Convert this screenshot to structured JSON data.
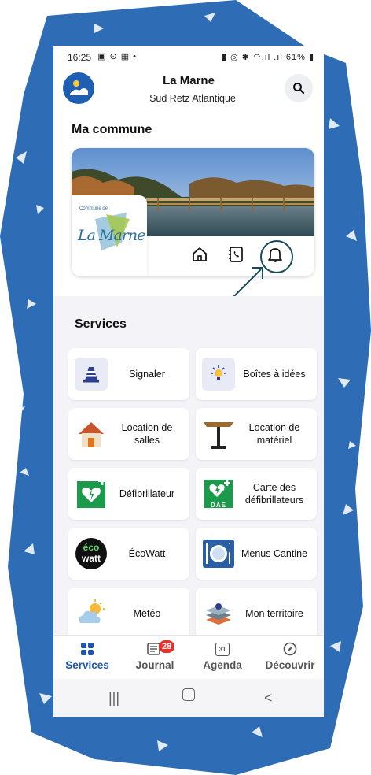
{
  "status_bar": {
    "time": "16:25",
    "left_icons": "▣ ⊙ ▦ •",
    "right_icons": "▮ ◎ ✱ ◠.ıl .ıl",
    "battery": "61%"
  },
  "header": {
    "title": "La Marne",
    "subtitle": "Sud Retz Atlantique"
  },
  "commune": {
    "section_title": "Ma commune",
    "logo_small_text": "Commune de",
    "logo_text": "La Marne"
  },
  "services": {
    "title": "Services",
    "tiles": [
      {
        "label": "Signaler",
        "icon": "cone-icon"
      },
      {
        "label": "Boîtes à idées",
        "icon": "lightbulb-icon"
      },
      {
        "label": "Location de salles",
        "icon": "house-icon"
      },
      {
        "label": "Location de matériel",
        "icon": "table-icon"
      },
      {
        "label": "Défibrillateur",
        "icon": "defibrillator-icon"
      },
      {
        "label": "Carte des défibrillateurs",
        "icon": "dae-icon"
      },
      {
        "label": "ÉcoWatt",
        "icon": "ecowatt-icon"
      },
      {
        "label": "Menus Cantine",
        "icon": "cutlery-icon"
      },
      {
        "label": "Météo",
        "icon": "weather-icon"
      },
      {
        "label": "Mon territoire",
        "icon": "map-layers-icon"
      }
    ],
    "ecowatt_logo": {
      "line1": "éco",
      "line2": "watt"
    },
    "dae_text": "DAE"
  },
  "bottom_nav": {
    "items": [
      {
        "label": "Services",
        "active": true
      },
      {
        "label": "Journal",
        "badge": "28"
      },
      {
        "label": "Agenda",
        "icon_text": "31"
      },
      {
        "label": "Découvrir"
      }
    ]
  },
  "colors": {
    "accent": "#1f57b0",
    "bell_ring": "#164b5c",
    "badge": "#e5312a",
    "splash": "#2e6db5"
  }
}
